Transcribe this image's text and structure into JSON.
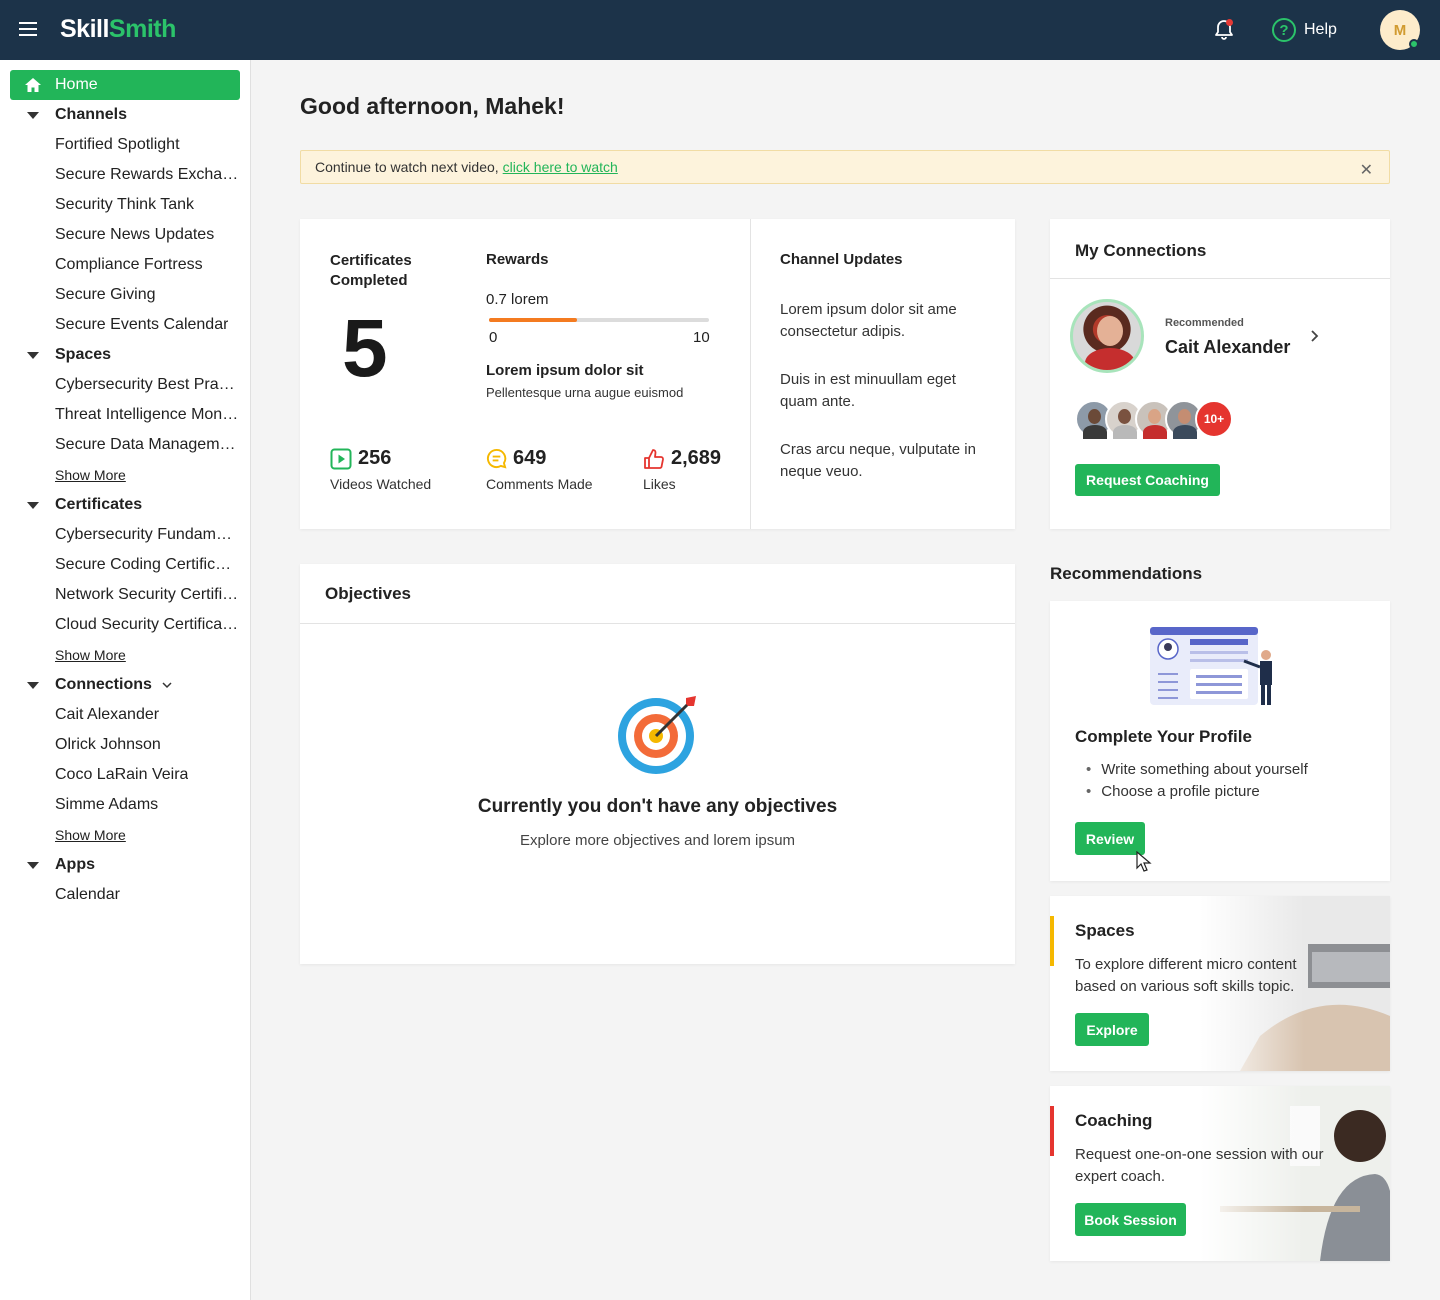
{
  "topbar": {
    "logo_part1": "Skill",
    "logo_part2": "Smith",
    "help_label": "Help",
    "avatar_initial": "M",
    "icons": [
      "menu-icon",
      "bell-icon",
      "help-circle-icon"
    ]
  },
  "sidebar": {
    "home": "Home",
    "sections": {
      "channels": {
        "title": "Channels",
        "items": [
          "Fortified Spotlight",
          "Secure Rewards Exchange",
          "Security Think Tank",
          "Secure News Updates",
          "Compliance Fortress",
          "Secure Giving",
          "Secure Events Calendar"
        ]
      },
      "spaces": {
        "title": "Spaces",
        "items": [
          "Cybersecurity Best Practices",
          "Threat Intelligence Monitoring",
          "Secure Data Management"
        ],
        "more": "Show More"
      },
      "certificates": {
        "title": "Certificates",
        "items": [
          "Cybersecurity Fundamentals",
          "Secure Coding Certification",
          "Network Security Certification",
          "Cloud Security Certification"
        ],
        "more": "Show More"
      },
      "connections": {
        "title": "Connections",
        "items": [
          "Cait Alexander",
          "Olrick Johnson",
          "Coco LaRain Veira",
          "Simme Adams"
        ],
        "more": "Show More"
      },
      "apps": {
        "title": "Apps",
        "items": [
          "Calendar"
        ]
      }
    }
  },
  "main": {
    "greeting": "Good afternoon, Mahek!",
    "banner": {
      "text": "Continue to watch next video,",
      "link": "click here to watch",
      "close": "✕"
    },
    "stats": {
      "cert_title": "Certificates Completed",
      "cert_count": "5",
      "rewards_title": "Rewards",
      "rewards_value": "0.7 lorem",
      "rewards_progress": 0.4,
      "rewards_min": "0",
      "rewards_max": "10",
      "rewards_heading": "Lorem ipsum dolor sit",
      "rewards_sub": "Pellentesque urna augue euismod",
      "videos_count": "256",
      "videos_label": "Videos Watched",
      "comments_count": "649",
      "comments_label": "Comments Made",
      "likes_count": "2,689",
      "likes_label": "Likes"
    },
    "channel_updates": {
      "title": "Channel Updates",
      "items": [
        "Lorem ipsum dolor sit ame consectetur adipis.",
        "Duis in est minuullam eget quam ante.",
        "Cras arcu neque, vulputate in neque veuo."
      ]
    },
    "connections": {
      "title": "My Connections",
      "recommended": "Recommended",
      "name": "Cait Alexander",
      "more_badge": "10+",
      "button": "Request Coaching"
    },
    "objectives": {
      "title": "Objectives",
      "empty_title": "Currently you don't have any objectives",
      "empty_sub": "Explore more objectives and lorem ipsum"
    },
    "recommendations": {
      "heading": "Recommendations",
      "profile": {
        "title": "Complete Your Profile",
        "items": [
          "Write something about yourself",
          "Choose a profile picture"
        ],
        "button": "Review"
      },
      "spaces": {
        "title": "Spaces",
        "text": "To explore different micro content based on various soft skills topic.",
        "button": "Explore",
        "accent": "#f5b800"
      },
      "coaching": {
        "title": "Coaching",
        "text": "Request one-on-one session with our expert coach.",
        "button": "Book Session",
        "accent": "#e5352f"
      }
    }
  },
  "colors": {
    "brand_green": "#22b559",
    "topbar": "#1c3349",
    "progress": "#f47b20"
  }
}
